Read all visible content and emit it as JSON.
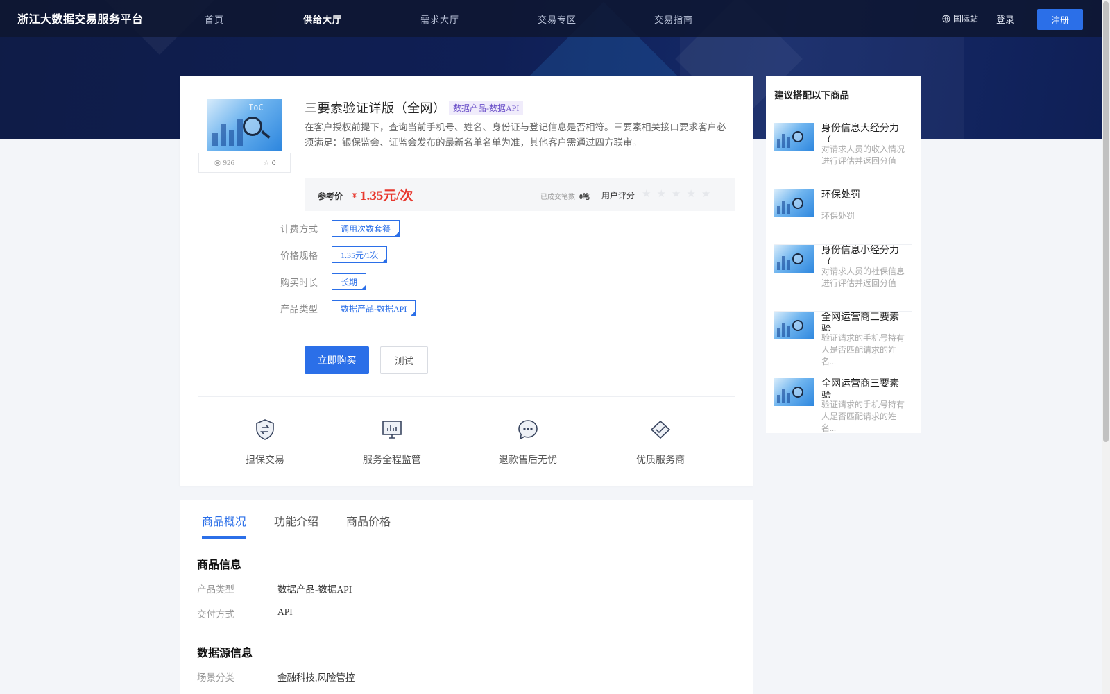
{
  "header": {
    "brand": "浙江大数据交易服务平台",
    "nav": [
      {
        "label": "首页",
        "active": false
      },
      {
        "label": "供给大厅",
        "active": true
      },
      {
        "label": "需求大厅",
        "active": false
      },
      {
        "label": "交易专区",
        "active": false
      },
      {
        "label": "交易指南",
        "active": false
      }
    ],
    "intl_label": "国际站",
    "login_label": "登录",
    "register_label": "注册"
  },
  "product": {
    "thumb_text": "IoC",
    "views": "926",
    "favorites": "0",
    "title": "三要素验证详版（全网）",
    "tag": "数据产品-数据API",
    "description": "在客户授权前提下，查询当前手机号、姓名、身份证与登记信息是否相符。三要素相关接口要求客户必须满足：银保监会、证监会发布的最新名单名单为准，其他客户需通过四方联审。",
    "price_label": "参考价",
    "price_symbol": "¥",
    "price_value": "1.35元/次",
    "deals_label": "已成交笔数",
    "deals_value": "0笔",
    "rating_label": "用户评分",
    "rating": 0,
    "rating_max": 5,
    "options": [
      {
        "label": "计费方式",
        "value": "调用次数套餐"
      },
      {
        "label": "价格规格",
        "value": "1.35元/1次"
      },
      {
        "label": "购买时长",
        "value": "长期"
      },
      {
        "label": "产品类型",
        "value": "数据产品-数据API"
      }
    ],
    "buy_label": "立即购买",
    "test_label": "测试"
  },
  "features": [
    {
      "label": "担保交易",
      "icon": "shield-exchange-icon"
    },
    {
      "label": "服务全程监管",
      "icon": "monitor-chart-icon"
    },
    {
      "label": "退款售后无忧",
      "icon": "chat-bubble-icon"
    },
    {
      "label": "优质服务商",
      "icon": "diamond-check-icon"
    }
  ],
  "sidebar": {
    "title": "建议搭配以下商品",
    "items": [
      {
        "name": "身份信息大经分力（",
        "desc": "对请求人员的收入情况进行评估并返回分值"
      },
      {
        "name": "环保处罚",
        "desc": "环保处罚"
      },
      {
        "name": "身份信息小经分力（",
        "desc": "对请求人员的社保信息进行评估并返回分值"
      },
      {
        "name": "全网运营商三要素验",
        "desc": "验证请求的手机号持有人是否匹配请求的姓名..."
      },
      {
        "name": "全网运营商三要素验",
        "desc": "验证请求的手机号持有人是否匹配请求的姓名..."
      }
    ]
  },
  "detail": {
    "tabs": [
      "商品概况",
      "功能介绍",
      "商品价格"
    ],
    "active_tab": "商品概况",
    "sections": [
      {
        "title": "商品信息",
        "rows": [
          {
            "key": "产品类型",
            "value": "数据产品-数据API"
          },
          {
            "key": "交付方式",
            "value": "API"
          }
        ]
      },
      {
        "title": "数据源信息",
        "rows": [
          {
            "key": "场景分类",
            "value": "金融科技,风险管控"
          }
        ]
      }
    ]
  },
  "colors": {
    "primary": "#2b6fe8",
    "price": "#e8382e",
    "header_bg": "#0f1c47",
    "tag_bg": "#f0ecfb",
    "tag_text": "#6a4fc8"
  }
}
